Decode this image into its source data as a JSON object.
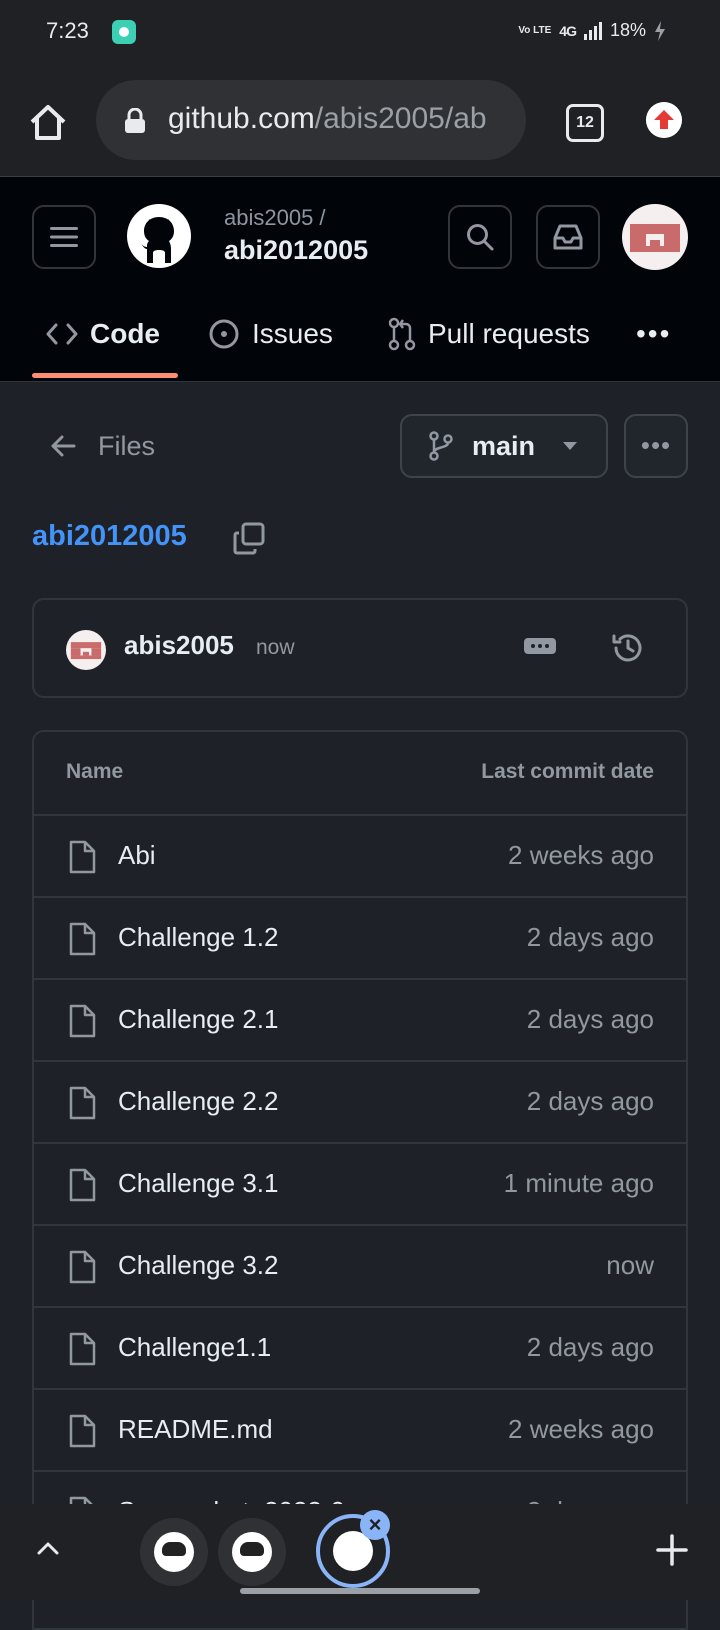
{
  "status_bar": {
    "time": "7:23",
    "volte": "Vo LTE",
    "network": "4G",
    "battery": "18%"
  },
  "browser": {
    "url_host": "github.com",
    "url_path": "/abis2005/ab",
    "tab_count": "12"
  },
  "header": {
    "owner": "abis2005 /",
    "repo": "abi2012005"
  },
  "nav": {
    "code": "Code",
    "issues": "Issues",
    "pulls": "Pull requests",
    "more": "•••"
  },
  "toolbar": {
    "files_label": "Files",
    "branch": "main",
    "more": "•••"
  },
  "repo_title": "abi2012005",
  "latest_commit": {
    "author": "abis2005",
    "time": "now"
  },
  "table": {
    "col_name": "Name",
    "col_date": "Last commit date",
    "rows": [
      {
        "name": "Abi",
        "date": "2 weeks ago"
      },
      {
        "name": "Challenge 1.2",
        "date": "2 days ago"
      },
      {
        "name": "Challenge 2.1",
        "date": "2 days ago"
      },
      {
        "name": "Challenge 2.2",
        "date": "2 days ago"
      },
      {
        "name": "Challenge 3.1",
        "date": "1 minute ago"
      },
      {
        "name": "Challenge 3.2",
        "date": "now"
      },
      {
        "name": "Challenge1.1",
        "date": "2 days ago"
      },
      {
        "name": "README.md",
        "date": "2 weeks ago"
      },
      {
        "name": "Screenshot_2023-0",
        "date": "2 days ago"
      }
    ]
  },
  "colors": {
    "accent_link": "#4493f8",
    "tab_underline": "#fd8c73",
    "bg": "#1e2228",
    "header_bg": "#010409"
  }
}
